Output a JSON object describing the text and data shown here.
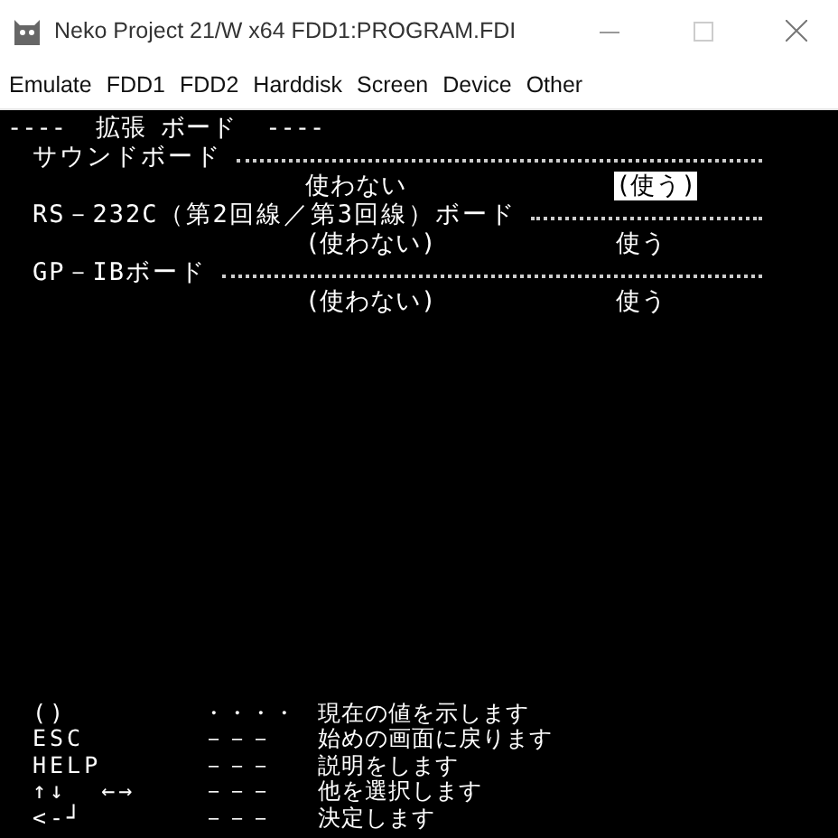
{
  "window": {
    "title": "Neko Project 21/W x64  FDD1:PROGRAM.FDI"
  },
  "menu": [
    "Emulate",
    "FDD1",
    "FDD2",
    "Harddisk",
    "Screen",
    "Device",
    "Other"
  ],
  "screen": {
    "heading": "----  拡張 ボード  ----",
    "boards": [
      {
        "label": "サウンドボード",
        "options": [
          {
            "text": "使わない",
            "selected": false
          },
          {
            "text": "(使う)",
            "selected": true
          }
        ]
      },
      {
        "label": "RS－232C（第2回線／第3回線）ボード",
        "options": [
          {
            "text": "(使わない)",
            "selected": false
          },
          {
            "text": "使う",
            "selected": false
          }
        ]
      },
      {
        "label": "GP－IBボード",
        "options": [
          {
            "text": "(使わない)",
            "selected": false
          },
          {
            "text": "使う",
            "selected": false
          }
        ]
      }
    ],
    "legend": [
      {
        "key": "()",
        "sep": "・・・・",
        "desc": "現在の値を示します"
      },
      {
        "key": "ESC",
        "sep": "－－－",
        "desc": "始めの画面に戻ります"
      },
      {
        "key": "HELP",
        "sep": "－－－",
        "desc": "説明をします"
      },
      {
        "key": "↑↓  ←→",
        "sep": "－－－",
        "desc": "他を選択します"
      },
      {
        "key": "<-┘",
        "sep": "－－－",
        "desc": "決定します"
      }
    ]
  }
}
